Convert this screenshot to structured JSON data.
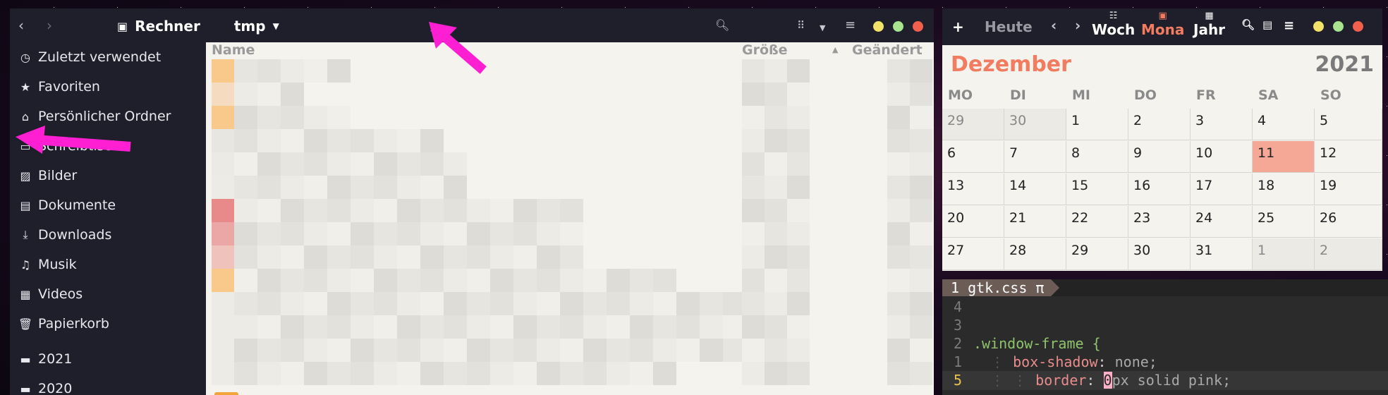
{
  "file_manager": {
    "location_app": "Rechner",
    "location_folder": "tmp",
    "sidebar": [
      {
        "label": "Zuletzt verwendet",
        "icon": "clock-icon"
      },
      {
        "label": "Favoriten",
        "icon": "star-icon"
      },
      {
        "label": "Persönlicher Ordner",
        "icon": "home-icon"
      },
      {
        "label": "Schreibtisch",
        "icon": "desktop-icon"
      },
      {
        "label": "Bilder",
        "icon": "image-icon"
      },
      {
        "label": "Dokumente",
        "icon": "document-icon"
      },
      {
        "label": "Downloads",
        "icon": "download-icon"
      },
      {
        "label": "Musik",
        "icon": "music-icon"
      },
      {
        "label": "Videos",
        "icon": "video-icon"
      },
      {
        "label": "Papierkorb",
        "icon": "trash-icon"
      },
      {
        "label": "2021",
        "icon": "folder-icon"
      },
      {
        "label": "2020",
        "icon": "folder-icon"
      }
    ],
    "columns": {
      "name": "Name",
      "size": "Größe",
      "modified": "Geändert"
    }
  },
  "calendar": {
    "today_button": "Heute",
    "views": {
      "week": "Woch",
      "month": "Mona",
      "year": "Jahr"
    },
    "month_name": "Dezember",
    "year": "2021",
    "weekdays": [
      "MO",
      "DI",
      "MI",
      "DO",
      "FR",
      "SA",
      "SO"
    ],
    "weeks": [
      [
        "29",
        "30",
        "1",
        "2",
        "3",
        "4",
        "5"
      ],
      [
        "6",
        "7",
        "8",
        "9",
        "10",
        "11",
        "12"
      ],
      [
        "13",
        "14",
        "15",
        "16",
        "17",
        "18",
        "19"
      ],
      [
        "20",
        "21",
        "22",
        "23",
        "24",
        "25",
        "26"
      ],
      [
        "27",
        "28",
        "29",
        "30",
        "31",
        "1",
        "2"
      ]
    ],
    "today": "11",
    "colors": {
      "accent": "#f27c5f",
      "today_bg": "#f6a897"
    }
  },
  "editor": {
    "tab_label": "1 gtk.css π",
    "lines": [
      {
        "num": "4",
        "code": ""
      },
      {
        "num": "3",
        "code": ""
      },
      {
        "num": "2",
        "selector": ".window-frame {"
      },
      {
        "num": "1",
        "property": "box-shadow",
        "value": "none;"
      },
      {
        "num": "5",
        "property": "border",
        "cursor_char": "0",
        "value_rest": "px solid pink;"
      }
    ]
  },
  "colors": {
    "headerbar": "#1f1f2b",
    "content_bg": "#f4f3ee",
    "annotation_arrow": "#ff1fd2"
  }
}
